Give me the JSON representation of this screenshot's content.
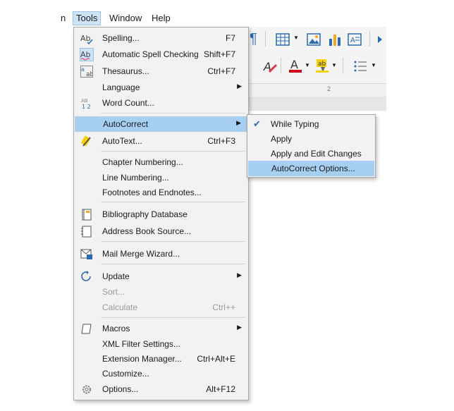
{
  "menubar": {
    "partial": "n",
    "tools": "Tools",
    "window": "Window",
    "help": "Help"
  },
  "tools_menu": {
    "items": [
      {
        "label": "Spelling...",
        "shortcut": "F7",
        "icon": "spelling-icon"
      },
      {
        "label": "Automatic Spell Checking",
        "shortcut": "Shift+F7",
        "icon": "auto-spellcheck-icon"
      },
      {
        "label": "Thesaurus...",
        "shortcut": "Ctrl+F7",
        "icon": "thesaurus-icon"
      },
      {
        "label": "Language",
        "shortcut": "",
        "icon": "",
        "submenu": true
      },
      {
        "label": "Word Count...",
        "shortcut": "",
        "icon": "word-count-icon"
      },
      {
        "label": "AutoCorrect",
        "shortcut": "",
        "icon": "",
        "submenu": true,
        "highlighted": true
      },
      {
        "label": "AutoText...",
        "shortcut": "Ctrl+F3",
        "icon": "autotext-icon"
      },
      {
        "label": "Chapter Numbering...",
        "shortcut": ""
      },
      {
        "label": "Line Numbering...",
        "shortcut": ""
      },
      {
        "label": "Footnotes and Endnotes...",
        "shortcut": ""
      },
      {
        "label": "Bibliography Database",
        "shortcut": "",
        "icon": "bibliography-icon"
      },
      {
        "label": "Address Book Source...",
        "shortcut": "",
        "icon": "address-book-icon"
      },
      {
        "label": "Mail Merge Wizard...",
        "shortcut": "",
        "icon": "mail-merge-icon"
      },
      {
        "label": "Update",
        "shortcut": "",
        "icon": "update-icon",
        "submenu": true
      },
      {
        "label": "Sort...",
        "shortcut": "",
        "disabled": true
      },
      {
        "label": "Calculate",
        "shortcut": "Ctrl++",
        "disabled": true
      },
      {
        "label": "Macros",
        "shortcut": "",
        "icon": "macros-icon",
        "submenu": true
      },
      {
        "label": "XML Filter Settings...",
        "shortcut": ""
      },
      {
        "label": "Extension Manager...",
        "shortcut": "Ctrl+Alt+E"
      },
      {
        "label": "Customize...",
        "shortcut": ""
      },
      {
        "label": "Options...",
        "shortcut": "Alt+F12",
        "icon": "options-gear-icon"
      }
    ]
  },
  "autocorrect_submenu": {
    "items": [
      {
        "label": "While Typing",
        "checked": true
      },
      {
        "label": "Apply"
      },
      {
        "label": "Apply and Edit Changes"
      },
      {
        "label": "AutoCorrect Options...",
        "highlighted": true
      }
    ]
  },
  "ruler": {
    "tick": "2"
  },
  "colors": {
    "highlight": "#a7cff2",
    "menu_bg": "#f2f2f2",
    "disabled": "#9a9a9a",
    "font_color_red": "#d0021b",
    "highlight_yellow": "#f5d20a",
    "chart_blue": "#2a6ab4"
  }
}
